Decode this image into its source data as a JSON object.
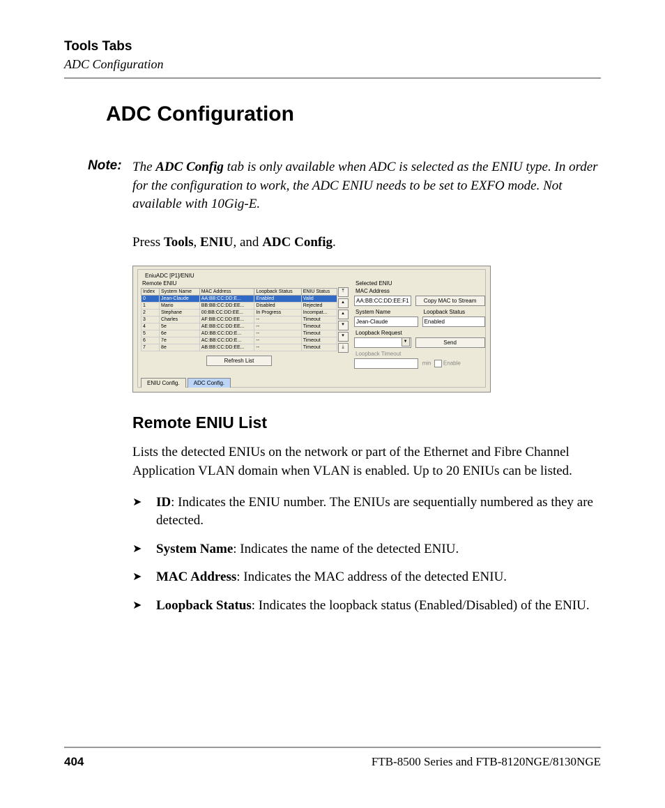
{
  "header": {
    "title": "Tools Tabs",
    "subtitle": "ADC Configuration"
  },
  "h1": "ADC Configuration",
  "note": {
    "label": "Note:",
    "pre": "The ",
    "bold": "ADC Config",
    "post": " tab is only available when ADC is selected as the ENIU type. In order for the configuration to work, the ADC ENIU needs to be set to EXFO mode. Not available with 10Gig-E."
  },
  "press": {
    "pre": "Press ",
    "b1": "Tools",
    "s1": ", ",
    "b2": "ENIU",
    "s2": ", and ",
    "b3": "ADC Config",
    "post": "."
  },
  "ui": {
    "title": "EniuADC [P1]/ENIU",
    "remote_label": "Remote ENIU",
    "headers": {
      "c0": "Index",
      "c1": "System Name",
      "c2": "MAC Address",
      "c3": "Loopback Status",
      "c4": "ENIU Status"
    },
    "rows": [
      {
        "i": "0",
        "n": "Jean-Claude",
        "m": "AA:BB:CC:DD:E...",
        "l": "Enabled",
        "s": "Valid",
        "sel": true
      },
      {
        "i": "1",
        "n": "Mario",
        "m": "BB:BB:CC:DD:EE...",
        "l": "Disabled",
        "s": "Rejected"
      },
      {
        "i": "2",
        "n": "Stephane",
        "m": "00:BB:CC:DD:EE...",
        "l": "In Progress",
        "s": "Incompat..."
      },
      {
        "i": "3",
        "n": "Charles",
        "m": "AF:BB:CC:DD:EE...",
        "l": "--",
        "s": "Timeout"
      },
      {
        "i": "4",
        "n": "5e",
        "m": "AE:BB:CC:DD:EE...",
        "l": "--",
        "s": "Timeout"
      },
      {
        "i": "5",
        "n": "6e",
        "m": "AD:BB:CC:DD:E...",
        "l": "--",
        "s": "Timeout"
      },
      {
        "i": "6",
        "n": "7e",
        "m": "AC:BB:CC:DD:E...",
        "l": "--",
        "s": "Timeout"
      },
      {
        "i": "7",
        "n": "8e",
        "m": "AB:BB:CC:DD:EE...",
        "l": "--",
        "s": "Timeout"
      }
    ],
    "refresh": "Refresh List",
    "tab1": "ENIU Config.",
    "tab2": "ADC Config.",
    "selected": {
      "label": "Selected ENIU",
      "mac_label": "MAC Address",
      "mac_value": "AA:BB:CC:DD:EE:F1",
      "copy_btn": "Copy MAC to Stream",
      "name_label": "System Name",
      "name_value": "Jean-Claude",
      "lb_label": "Loopback Status",
      "lb_value": "Enabled",
      "req_label": "Loopback Request",
      "send_btn": "Send",
      "to_label": "Loopback Timeout",
      "min": "min",
      "enable": "Enable"
    }
  },
  "h2": "Remote ENIU List",
  "intro": "Lists the detected ENIUs on the network or part of the Ethernet and Fibre Channel Application VLAN domain when VLAN is enabled. Up to 20 ENIUs can be listed.",
  "bullets": [
    {
      "b": "ID",
      "t": ": Indicates the ENIU number. The ENIUs are sequentially numbered as they are detected."
    },
    {
      "b": "System Name",
      "t": ": Indicates the name of the detected ENIU."
    },
    {
      "b": "MAC Address",
      "t": ": Indicates the MAC address of the detected ENIU."
    },
    {
      "b": "Loopback Status",
      "t": ": Indicates the loopback status (Enabled/Disabled) of the ENIU."
    }
  ],
  "footer": {
    "page": "404",
    "doc": "FTB-8500 Series and FTB-8120NGE/8130NGE"
  }
}
